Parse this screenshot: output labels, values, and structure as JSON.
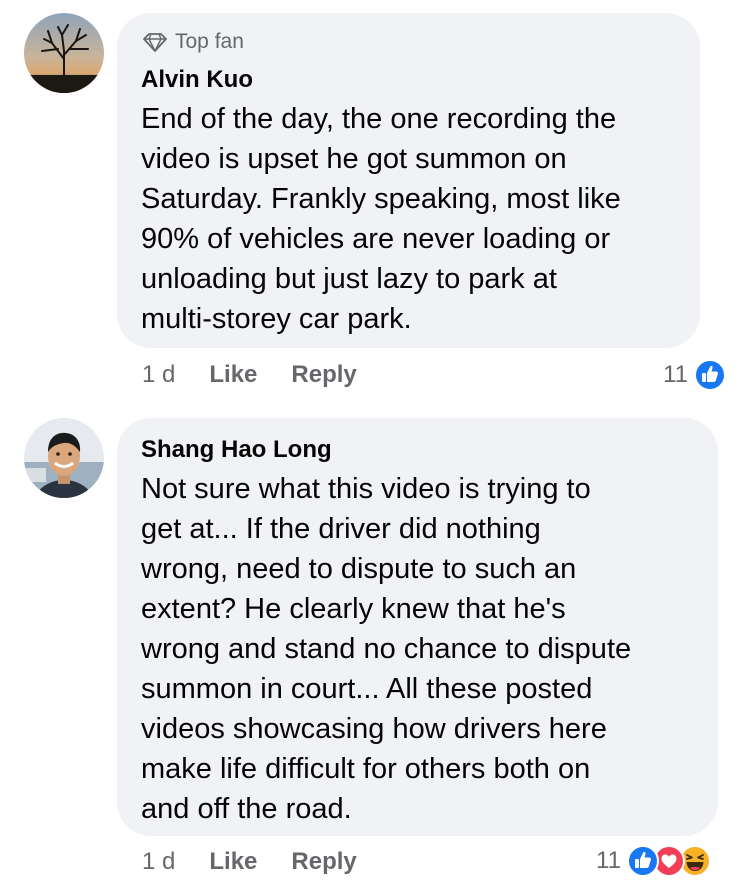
{
  "comments": [
    {
      "badge": "Top fan",
      "author": "Alvin Kuo",
      "text": "End of the day, the one recording the\nvideo is upset he got summon on\nSaturday. Frankly speaking, most like\n90% of vehicles are never loading or\nunloading but just lazy to park at\nmulti-storey car park.",
      "time": "1 d",
      "like_label": "Like",
      "reply_label": "Reply",
      "reaction_count": "11",
      "reactions": [
        "like-icon"
      ]
    },
    {
      "author": "Shang Hao Long",
      "text": "Not sure what this video is trying to\nget at... If the driver did nothing\nwrong, need to dispute to such an\nextent? He clearly knew that he's\nwrong and stand no chance to dispute\nsummon in court... All these posted\nvideos showcasing how drivers here\nmake life difficult for others both on\nand off the road.",
      "time": "1 d",
      "like_label": "Like",
      "reply_label": "Reply",
      "reaction_count": "11",
      "reactions": [
        "like-icon",
        "love-icon",
        "haha-icon"
      ]
    }
  ],
  "colors": {
    "bubble": "#f0f2f5",
    "meta_text": "#65676b",
    "like_blue": "#1877f2",
    "love_red": "#f33e58",
    "haha_yellow": "#f7b125"
  }
}
